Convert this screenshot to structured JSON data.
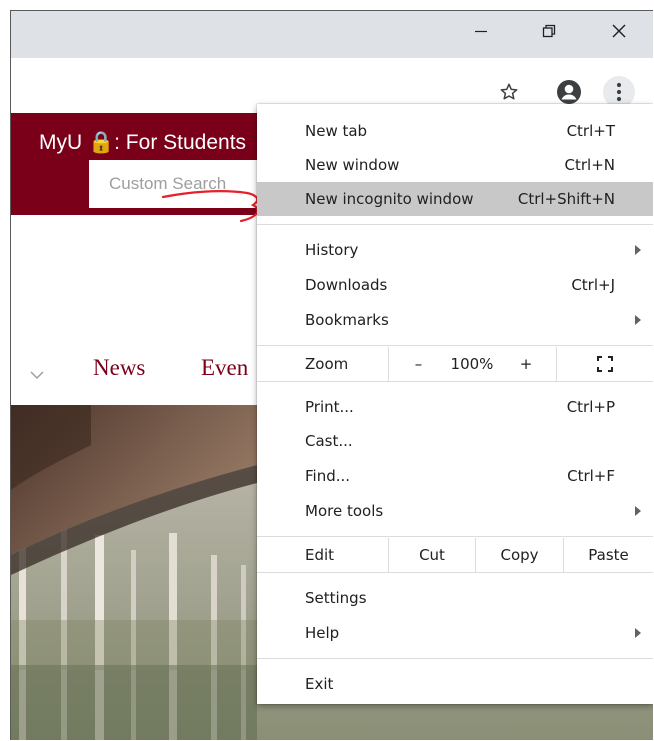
{
  "site": {
    "title": "MyU 🔒: For Students",
    "search_placeholder": "Custom Search",
    "nav": [
      "News",
      "Even"
    ]
  },
  "menu": {
    "items_top": [
      {
        "label": "New tab",
        "shortcut": "Ctrl+T"
      },
      {
        "label": "New window",
        "shortcut": "Ctrl+N"
      },
      {
        "label": "New incognito window",
        "shortcut": "Ctrl+Shift+N"
      }
    ],
    "history": "History",
    "downloads": {
      "label": "Downloads",
      "shortcut": "Ctrl+J"
    },
    "bookmarks": "Bookmarks",
    "zoom": {
      "label": "Zoom",
      "minus": "–",
      "level": "100%",
      "plus": "+"
    },
    "print": {
      "label": "Print...",
      "shortcut": "Ctrl+P"
    },
    "cast": "Cast...",
    "find": {
      "label": "Find...",
      "shortcut": "Ctrl+F"
    },
    "more_tools": "More tools",
    "edit": {
      "label": "Edit",
      "cut": "Cut",
      "copy": "Copy",
      "paste": "Paste"
    },
    "settings": "Settings",
    "help": "Help",
    "exit": "Exit"
  },
  "colors": {
    "brand_maroon": "#7a0019",
    "titlebar": "#dee1e6",
    "menu_highlight": "#c8c8c8",
    "annotation_red": "#e8202a"
  },
  "icons": [
    "minimize-icon",
    "restore-icon",
    "close-icon",
    "star-icon",
    "profile-icon",
    "more-vert-icon",
    "chevron-down-icon",
    "fullscreen-icon",
    "lock-icon"
  ]
}
